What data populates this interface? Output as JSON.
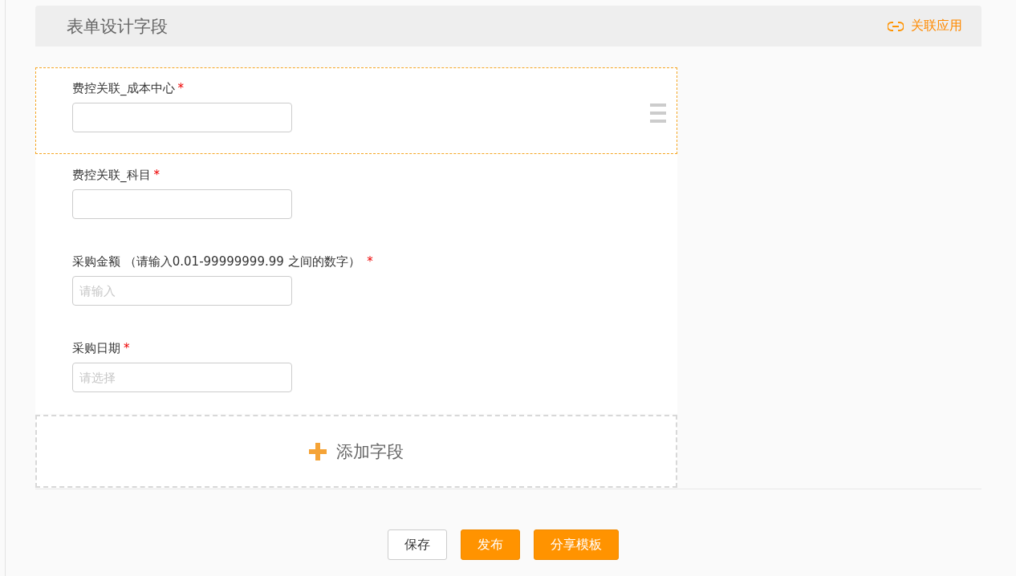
{
  "header": {
    "title": "表单设计字段",
    "link": "关联应用"
  },
  "fields": [
    {
      "label": "费控关联_成本中心",
      "required_mark": "*",
      "selected": true
    },
    {
      "label": "费控关联_科目",
      "required_mark": "*",
      "selected": false
    },
    {
      "label": "采购金额 （请输入0.01-99999999.99 之间的数字） ",
      "required_mark": "*",
      "selected": false,
      "placeholder": "请输入"
    },
    {
      "label": "采购日期",
      "required_mark": "*",
      "selected": false,
      "placeholder": "请选择"
    }
  ],
  "add_field": "添加字段",
  "buttons": [
    {
      "label": "保存",
      "kind": "default"
    },
    {
      "label": "发布",
      "kind": "primary"
    },
    {
      "label": "分享模板",
      "kind": "primary"
    }
  ]
}
